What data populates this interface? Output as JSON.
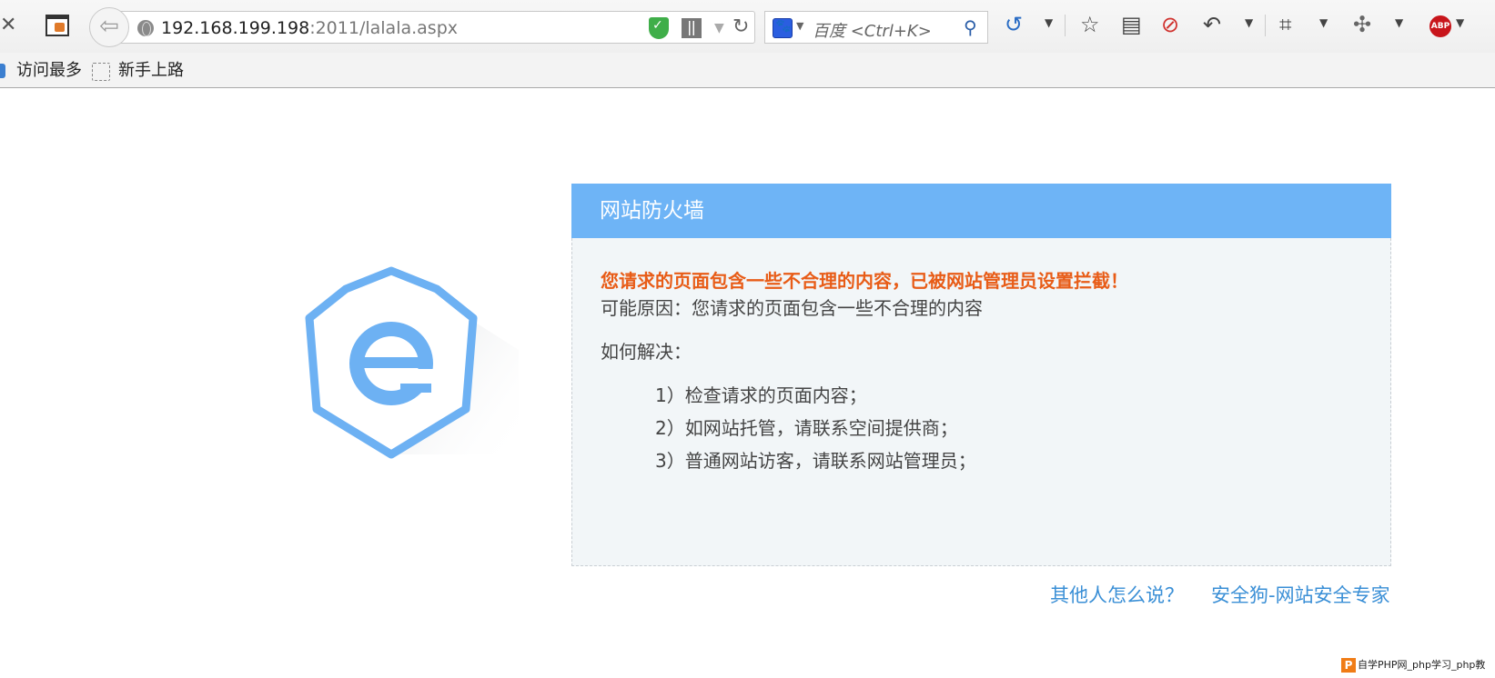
{
  "browser": {
    "url_host": "192.168.199.198",
    "url_rest": ":2011/lalala.aspx",
    "search_placeholder": "百度 <Ctrl+K>",
    "close_glyph": "✕",
    "bookmarks": [
      "访问最多",
      "新手上路"
    ]
  },
  "firewall": {
    "title": "网站防火墙",
    "warning": "您请求的页面包含一些不合理的内容，已被网站管理员设置拦截！",
    "reason": "可能原因：您请求的页面包含一些不合理的内容",
    "howto": "如何解决：",
    "steps": [
      "1）检查请求的页面内容；",
      "2）如网站托管，请联系空间提供商；",
      "3）普通网站访客，请联系网站管理员；"
    ]
  },
  "footer": {
    "link_others": "其他人怎么说？",
    "link_safedog": "安全狗-网站安全专家"
  },
  "watermark": {
    "logo_letter": "P",
    "text": "自学PHP网_php学习_php教"
  },
  "colors": {
    "header_blue": "#6eb4f6",
    "warning_orange": "#e85c17",
    "link_blue": "#3a8fd6",
    "panel_bg": "#f2f6f8",
    "logo_blue": "#6db1f3"
  }
}
